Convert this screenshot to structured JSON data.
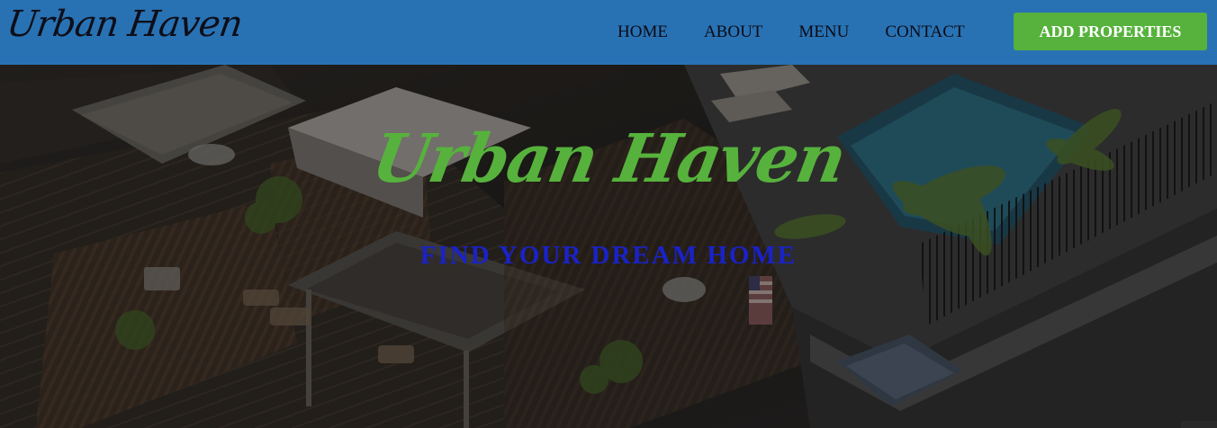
{
  "brand": {
    "name": "Urban Haven"
  },
  "nav": {
    "links": [
      {
        "label": "HOME"
      },
      {
        "label": "ABOUT"
      },
      {
        "label": "MENU"
      },
      {
        "label": "CONTACT"
      }
    ],
    "cta_label": "ADD PROPERTIES"
  },
  "hero": {
    "title": "Urban Haven",
    "subtitle": "FIND YOUR DREAM HOME",
    "background_image": "rooftop-patio-with-pool-photo"
  },
  "colors": {
    "navbar": "#2872b4",
    "accent_green": "#56b23c",
    "subtitle_blue": "#1a22c8",
    "nav_text": "#0b0b14"
  }
}
